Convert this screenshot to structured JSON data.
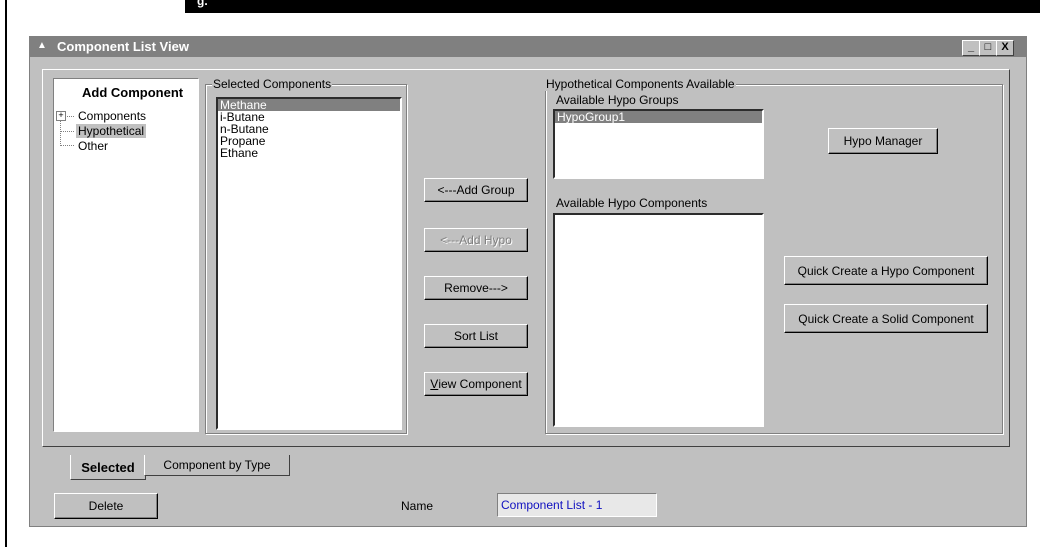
{
  "page": {
    "header_fragment": "g."
  },
  "window": {
    "title": "Component List View",
    "buttons": {
      "minimize": "_",
      "maximize": "□",
      "close": "X"
    }
  },
  "add_component": {
    "heading": "Add Component",
    "tree": [
      {
        "label": "Components",
        "expandable": true,
        "selected": false
      },
      {
        "label": "Hypothetical",
        "expandable": false,
        "selected": true
      },
      {
        "label": "Other",
        "expandable": false,
        "selected": false
      }
    ]
  },
  "selected_components": {
    "legend": "Selected Components",
    "items": [
      "Methane",
      "i-Butane",
      "n-Butane",
      "Propane",
      "Ethane"
    ],
    "selected_index": 0
  },
  "action_buttons": {
    "add_group": "<---Add Group",
    "add_hypo": "<---Add Hypo",
    "remove": "Remove--->",
    "sort_list": "Sort List",
    "view_component_underline": "V",
    "view_component_rest": "iew Component"
  },
  "hypo": {
    "legend": "Hypothetical Components Available",
    "groups_label": "Available Hypo Groups",
    "groups": [
      "HypoGroup1"
    ],
    "components_label": "Available Hypo Components",
    "components": [],
    "hypo_manager": "Hypo Manager",
    "quick_hypo": "Quick Create a Hypo Component",
    "quick_solid": "Quick Create a Solid Component"
  },
  "tabs": [
    {
      "label": "Selected",
      "active": true
    },
    {
      "label": "Component by Type",
      "active": false
    }
  ],
  "footer": {
    "delete": "Delete",
    "name_label": "Name",
    "name_value": "Component List - 1"
  }
}
